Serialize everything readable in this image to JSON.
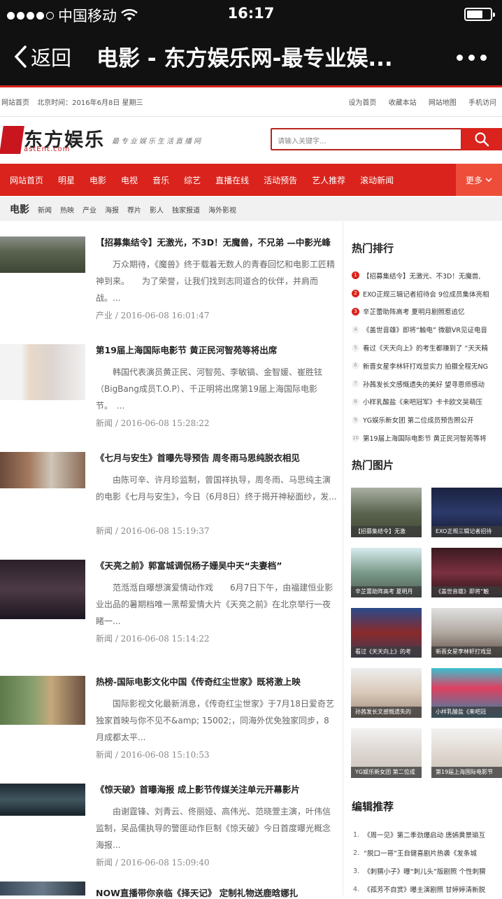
{
  "status": {
    "carrier": "中国移动",
    "time": "16:17"
  },
  "navbar": {
    "back_label": "返回",
    "title": "电影 - 东方娱乐网-最专业娱..."
  },
  "top_links": {
    "left": [
      "网站首页",
      "北京时间：2016年6月8日 星期三"
    ],
    "right": [
      "设为首页",
      "收藏本站",
      "网站地图",
      "手机访问"
    ]
  },
  "logo": {
    "cn": "东方娱乐",
    "en": "astEnt.com",
    "slogan": "最专业娱乐生活直播网"
  },
  "search": {
    "placeholder": "请输入关键字..."
  },
  "main_nav": {
    "items": [
      "网站首页",
      "明星",
      "电影",
      "电视",
      "音乐",
      "综艺",
      "直播在线",
      "活动预告",
      "艺人推荐",
      "滚动新闻"
    ],
    "more": "更多"
  },
  "sub_nav": {
    "heading": "电影",
    "items": [
      "新闻",
      "热映",
      "产业",
      "海报",
      "荐片",
      "影人",
      "独家报道",
      "海外影视"
    ]
  },
  "articles": [
    {
      "title": "【招募集结令】无激光，不3D！无魔兽，不兄弟 —中影光峰",
      "summary": "万众期待，《魔兽》终于载着无数人的青春回忆和电影工匠精神到来。　　为了荣誉，让我们找到志同道合的伙伴，并肩而战。...",
      "meta": "产业 / 2016-06-08 16:01:47"
    },
    {
      "title": "第19届上海国际电影节 黄正民河智苑等将出席",
      "summary": "韩国代表演员黄正民、河智苑、李敏镐、金智媛、崔胜铉（BigBang成员T.O.P）、千正明将出席第19届上海国际电影节。　...",
      "meta": "新闻 / 2016-06-08 15:28:22"
    },
    {
      "title": "《七月与安生》首曝先导预告 周冬雨马思纯脱衣相见",
      "summary": "由陈可辛、许月珍监制，曾国祥执导，周冬雨、马思纯主演的电影《七月与安生》，今日（6月8日）终于揭开神秘面纱，发...",
      "meta": "新闻 / 2016-06-08 15:19:37"
    },
    {
      "title": "《天亮之前》郭富城调侃杨子姗吴中天“夫妻档”",
      "summary": "范湉湉自曝想演爱情动作戏　　6月7日下午，由福建恒业影业出品的暑期档唯一黑帮爱情大片《天亮之前》在北京举行一夜睹一...",
      "meta": "新闻 / 2016-06-08 15:14:22"
    },
    {
      "title": "热榜-国际电影文化中国《传奇红尘世家》既将激上映",
      "summary": "国际影视文化最新消息，《传奇红尘世家》于7月18日爱奇艺独家首映与你不见不&amp; 15002;，同海外优免独家同步，8月成都太平...",
      "meta": "新闻 / 2016-06-08 15:10:53"
    },
    {
      "title": "《惊天破》首曝海报 成上影节传媒关注单元开幕影片",
      "summary": "由谢霆锋、刘青云、佟丽娅、高伟光、范晓萱主演，叶伟信监制，吴品儒执导的警匪动作巨制《惊天破》今日首度曝光概念海报...",
      "meta": "新闻 / 2016-06-08 15:09:40"
    },
    {
      "title": "NOW直播带你亲临《择天记》 定制礼物送鹿晗娜扎",
      "summary": "",
      "meta": ""
    }
  ],
  "hot_rank": {
    "heading": "热门排行",
    "items": [
      {
        "n": "1",
        "text": "【招募集结令】无激光、不3D！无魔兽,"
      },
      {
        "n": "2",
        "text": "EXO正规三辑记者招待会 9位成员集体亮相"
      },
      {
        "n": "3",
        "text": "辛芷蕾助阵高考 夏明月剧照惹追忆"
      },
      {
        "n": "4",
        "text": "《盖世音雄》即将“触电” 微额VR见证电音"
      },
      {
        "n": "5",
        "text": "看过《天天向上》的考生都赚到了 “天天精"
      },
      {
        "n": "6",
        "text": "新晋女星李林轩打戏显实力 拍摄全程无NG"
      },
      {
        "n": "7",
        "text": "孙茜发长文感慨遗失的美好 望寻恩师感动"
      },
      {
        "n": "8",
        "text": "小样乳酸盐《来吧冠军》卡卡欧文吴萌压"
      },
      {
        "n": "9",
        "text": "YG娱乐新女团 第二位成员预告照公开"
      },
      {
        "n": "10",
        "text": "第19届上海国际电影节 黄正民河智苑等将"
      }
    ]
  },
  "hot_pics": {
    "heading": "热门图片",
    "items": [
      {
        "caption": "【招募集结令】无激"
      },
      {
        "caption": "EXO正规三辑记者招待"
      },
      {
        "caption": "辛芷蕾助阵高考 夏明月"
      },
      {
        "caption": "《盖世音雄》即将“触"
      },
      {
        "caption": "看过《天天向上》的考"
      },
      {
        "caption": "新晋女星李林轩打戏显"
      },
      {
        "caption": "孙茜发长文感慨遗失的"
      },
      {
        "caption": "小样乳酸盐《来吧冠"
      },
      {
        "caption": "YG娱乐新女团 第二位成"
      },
      {
        "caption": "第19届上海国际电影节"
      }
    ]
  },
  "editor_pick": {
    "heading": "编辑推荐",
    "items": [
      {
        "n": "1.",
        "text": "《周一见》第二季劲爆启动 唐嫣黄景瑜互"
      },
      {
        "n": "2.",
        "text": "“脱口一哥”王自健喜剧片热袭《发条城"
      },
      {
        "n": "3.",
        "text": "《刺猬小子》曝“刺儿头”版剧照 个性刺猬"
      },
      {
        "n": "4.",
        "text": "《孤芳不自赏》曝主演剧照 甘婷婷清新脱"
      }
    ]
  },
  "colors": {
    "brand_red": "#d9231c",
    "nav_more_bg": "#ee4d3a",
    "status_bar": "#111111"
  }
}
